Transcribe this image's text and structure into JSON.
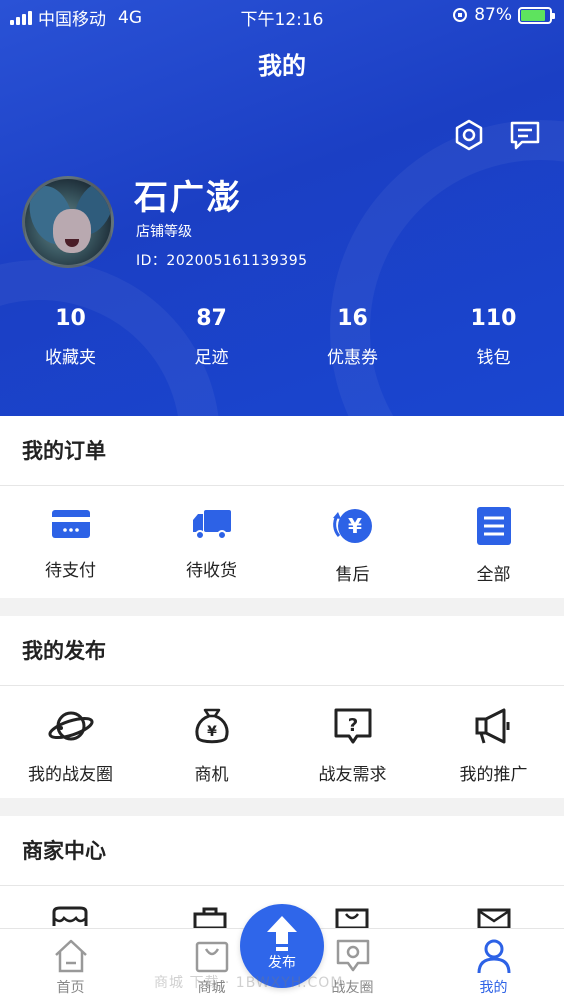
{
  "status_bar": {
    "carrier": "中国移动",
    "network": "4G",
    "time": "下午12:16",
    "battery": "87%"
  },
  "page_title": "我的",
  "profile": {
    "name": "石广澎",
    "level_label": "店铺等级",
    "id_text": "ID：202005161139395"
  },
  "stats": [
    {
      "value": "10",
      "label": "收藏夹"
    },
    {
      "value": "87",
      "label": "足迹"
    },
    {
      "value": "16",
      "label": "优惠券"
    },
    {
      "value": "110",
      "label": "钱包"
    }
  ],
  "orders": {
    "title": "我的订单",
    "items": [
      {
        "label": "待支付",
        "icon": "card-icon"
      },
      {
        "label": "待收货",
        "icon": "truck-icon"
      },
      {
        "label": "售后",
        "icon": "yuan-refresh-icon"
      },
      {
        "label": "全部",
        "icon": "list-icon"
      }
    ]
  },
  "publish": {
    "title": "我的发布",
    "items": [
      {
        "label": "我的战友圈",
        "icon": "planet-icon"
      },
      {
        "label": "商机",
        "icon": "money-bag-icon"
      },
      {
        "label": "战友需求",
        "icon": "question-bubble-icon"
      },
      {
        "label": "我的推广",
        "icon": "megaphone-icon"
      }
    ]
  },
  "merchant": {
    "title": "商家中心"
  },
  "tabbar": {
    "items": [
      {
        "label": "首页",
        "icon": "home-icon"
      },
      {
        "label": "商城",
        "icon": "bag-icon"
      },
      {
        "label": "战友圈",
        "icon": "chat-location-icon"
      },
      {
        "label": "我的",
        "icon": "person-icon",
        "active": true
      }
    ],
    "publish_label": "发布"
  },
  "watermark": "商城 下载 · 1BWXYH.COM",
  "colors": {
    "header_blue": "#1f46cc",
    "accent": "#2d62e6",
    "battery_green": "#5ee35e"
  }
}
